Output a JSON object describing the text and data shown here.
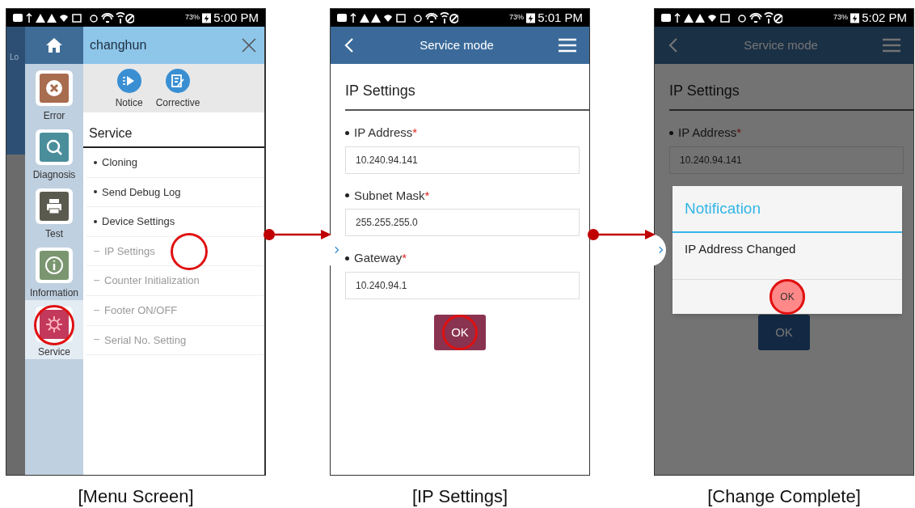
{
  "screens": [
    {
      "kind": "menu",
      "status": {
        "battery": "73%",
        "time": "5:00 PM"
      },
      "background_text": "Lo",
      "drawer_title": "changhun",
      "shortcuts": [
        {
          "label": "Notice",
          "kind": "notice"
        },
        {
          "label": "Corrective",
          "kind": "corrective"
        }
      ],
      "rail": [
        {
          "label": "Error",
          "kind": "error",
          "color": "#a86c4e",
          "selected": false,
          "tapped": false
        },
        {
          "label": "Diagnosis",
          "kind": "diagnosis",
          "color": "#4a8e9c",
          "selected": false,
          "tapped": false
        },
        {
          "label": "Test",
          "kind": "test",
          "color": "#5b5a4f",
          "selected": false,
          "tapped": false
        },
        {
          "label": "Information",
          "kind": "information",
          "color": "#7a9670",
          "selected": false,
          "tapped": false
        },
        {
          "label": "Service",
          "kind": "service",
          "color": "#c2395c",
          "selected": true,
          "tapped": true
        }
      ],
      "section": "Service",
      "items": [
        {
          "label": "Cloning",
          "kind": "main",
          "tapped": false
        },
        {
          "label": "Send Debug Log",
          "kind": "main",
          "tapped": false
        },
        {
          "label": "Device Settings",
          "kind": "main",
          "tapped": false
        },
        {
          "label": "IP Settings",
          "kind": "sub",
          "tapped": true
        },
        {
          "label": "Counter Initialization",
          "kind": "sub",
          "tapped": false
        },
        {
          "label": "Footer ON/OFF",
          "kind": "sub",
          "tapped": false
        },
        {
          "label": "Serial No. Setting",
          "kind": "sub",
          "tapped": false
        }
      ],
      "caption": "[Menu Screen]"
    },
    {
      "kind": "form",
      "status": {
        "battery": "73%",
        "time": "5:01 PM"
      },
      "title": "Service mode",
      "heading": "IP Settings",
      "fields": [
        {
          "label": "IP Address",
          "required_mark": "*",
          "value": "10.240.94.141"
        },
        {
          "label": "Subnet Mask",
          "required_mark": "*",
          "value": "255.255.255.0"
        },
        {
          "label": "Gateway",
          "required_mark": "*",
          "value": "10.240.94.1"
        }
      ],
      "button": {
        "label": "OK",
        "tapped": true
      },
      "caption": "[IP Settings]"
    },
    {
      "kind": "form",
      "status": {
        "battery": "73%",
        "time": "5:02 PM"
      },
      "title": "Service mode",
      "heading": "IP Settings",
      "fields": [
        {
          "label": "IP Address",
          "required_mark": "*",
          "value": "10.240.94.141"
        }
      ],
      "button": {
        "label": "OK",
        "tapped": false
      },
      "dialog": {
        "title": "Notification",
        "message": "IP Address Changed",
        "button": {
          "label": "OK",
          "tapped": true
        }
      },
      "caption": "[Change Complete]"
    }
  ]
}
